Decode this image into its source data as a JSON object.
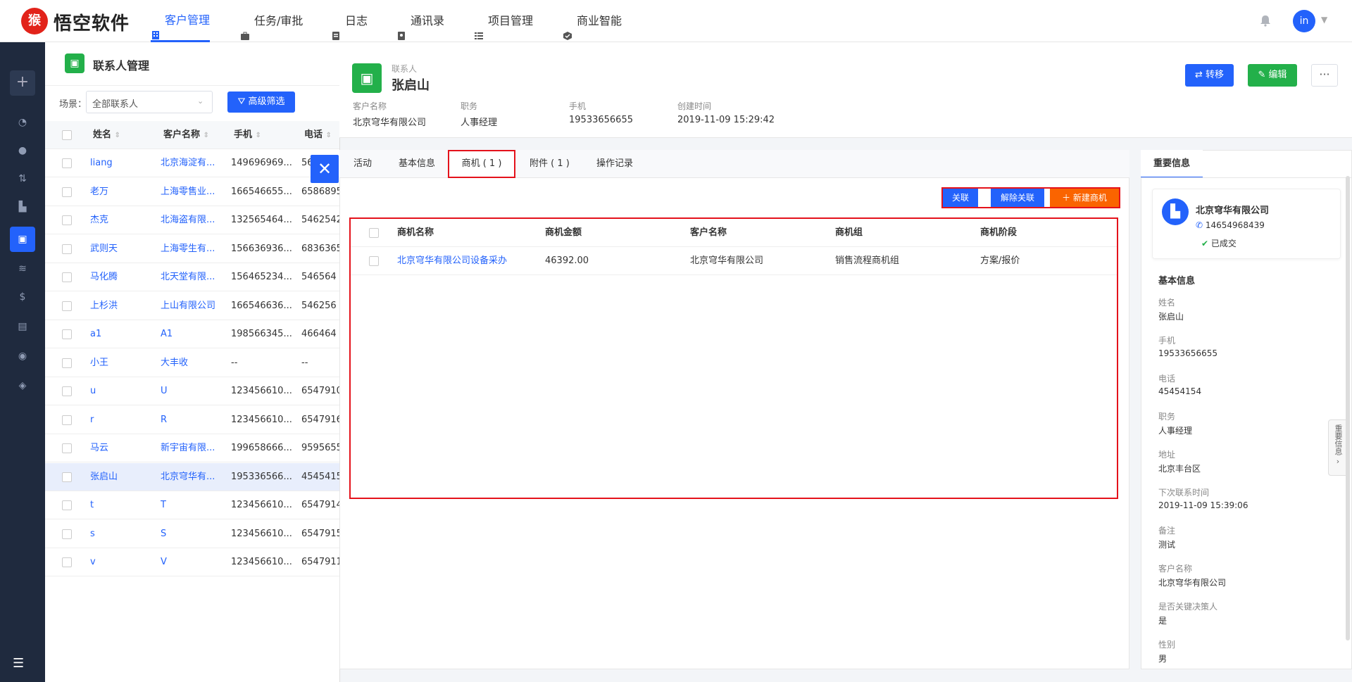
{
  "topnav": {
    "brand": "悟空软件",
    "items": [
      {
        "label": "客户管理",
        "icon": "building-icon",
        "active": true
      },
      {
        "label": "任务/审批",
        "icon": "briefcase-icon",
        "active": false
      },
      {
        "label": "日志",
        "icon": "doc-icon",
        "active": false
      },
      {
        "label": "通讯录",
        "icon": "phone-book-icon",
        "active": false
      },
      {
        "label": "项目管理",
        "icon": "list-icon",
        "active": false
      },
      {
        "label": "商业智能",
        "icon": "chart-icon",
        "active": false
      }
    ],
    "avatar_text": "in"
  },
  "sidebar": {
    "add_label": "+",
    "toggle_label": "☰"
  },
  "list": {
    "title": "联系人管理",
    "scene_label": "场景：",
    "scene_value": "全部联系人",
    "adv_filter_label": "高级筛选",
    "columns": [
      "姓名",
      "客户名称",
      "手机",
      "电话"
    ],
    "rows": [
      {
        "name": "liang",
        "customer": "北京海淀有...",
        "mobile": "149696969...",
        "phone": "56"
      },
      {
        "name": "老万",
        "customer": "上海零售业...",
        "mobile": "166546655...",
        "phone": "6586895"
      },
      {
        "name": "杰克",
        "customer": "北海盗有限...",
        "mobile": "132565464...",
        "phone": "5462542"
      },
      {
        "name": "武则天",
        "customer": "上海零生有...",
        "mobile": "156636936...",
        "phone": "6836365"
      },
      {
        "name": "马化腾",
        "customer": "北天堂有限...",
        "mobile": "156465234...",
        "phone": "546564"
      },
      {
        "name": "上杉洪",
        "customer": "上山有限公司",
        "mobile": "166546636...",
        "phone": "546256"
      },
      {
        "name": "a1",
        "customer": "A1",
        "mobile": "198566345...",
        "phone": "466464"
      },
      {
        "name": "小王",
        "customer": "大丰收",
        "mobile": "--",
        "phone": "--"
      },
      {
        "name": "u",
        "customer": "U",
        "mobile": "123456610...",
        "phone": "6547910"
      },
      {
        "name": "r",
        "customer": "R",
        "mobile": "123456610...",
        "phone": "6547916"
      },
      {
        "name": "马云",
        "customer": "新宇宙有限...",
        "mobile": "199658666...",
        "phone": "9595655"
      },
      {
        "name": "张启山",
        "customer": "北京穹华有...",
        "mobile": "195336566...",
        "phone": "4545415"
      },
      {
        "name": "t",
        "customer": "T",
        "mobile": "123456610...",
        "phone": "6547914"
      },
      {
        "name": "s",
        "customer": "S",
        "mobile": "123456610...",
        "phone": "6547915"
      },
      {
        "name": "v",
        "customer": "V",
        "mobile": "123456610...",
        "phone": "6547911"
      }
    ]
  },
  "detail": {
    "type_label": "联系人",
    "name": "张启山",
    "fields": [
      {
        "label": "客户名称",
        "value": "北京穹华有限公司"
      },
      {
        "label": "职务",
        "value": "人事经理"
      },
      {
        "label": "手机",
        "value": "19533656655"
      },
      {
        "label": "创建时间",
        "value": "2019-11-09 15:29:42"
      }
    ],
    "btn_transfer": "转移",
    "btn_edit": "编辑",
    "btn_more": "···",
    "tabs": [
      "活动",
      "基本信息",
      "商机 ( 1 )",
      "附件 ( 1 )",
      "操作记录"
    ],
    "actions": {
      "link": "关联",
      "unlink": "解除关联",
      "new": "新建商机"
    },
    "biz_columns": [
      "商机名称",
      "商机金额",
      "客户名称",
      "商机组",
      "商机阶段"
    ],
    "biz_rows": [
      {
        "name": "北京穹华有限公司设备采办",
        "amount": "46392.00",
        "customer": "北京穹华有限公司",
        "group": "销售流程商机组",
        "stage": "方案/报价"
      }
    ]
  },
  "info": {
    "tab_label": "重要信息",
    "company_name": "北京穹华有限公司",
    "company_phone": "14654968439",
    "company_status": "已成交",
    "section_title": "基本信息",
    "fields": [
      {
        "label": "姓名",
        "value": "张启山"
      },
      {
        "label": "手机",
        "value": "19533656655"
      },
      {
        "label": "电话",
        "value": "45454154"
      },
      {
        "label": "职务",
        "value": "人事经理"
      },
      {
        "label": "地址",
        "value": "北京丰台区"
      },
      {
        "label": "下次联系时间",
        "value": "2019-11-09 15:39:06"
      },
      {
        "label": "备注",
        "value": "测试"
      },
      {
        "label": "客户名称",
        "value": "北京穹华有限公司"
      },
      {
        "label": "是否关键决策人",
        "value": "是"
      },
      {
        "label": "性别",
        "value": "男"
      }
    ],
    "side_pull_label": "重要信息"
  },
  "colors": {
    "primary": "#2362fb",
    "green": "#23b04a",
    "orange": "#fa6400",
    "highlight": "#e4121b"
  }
}
